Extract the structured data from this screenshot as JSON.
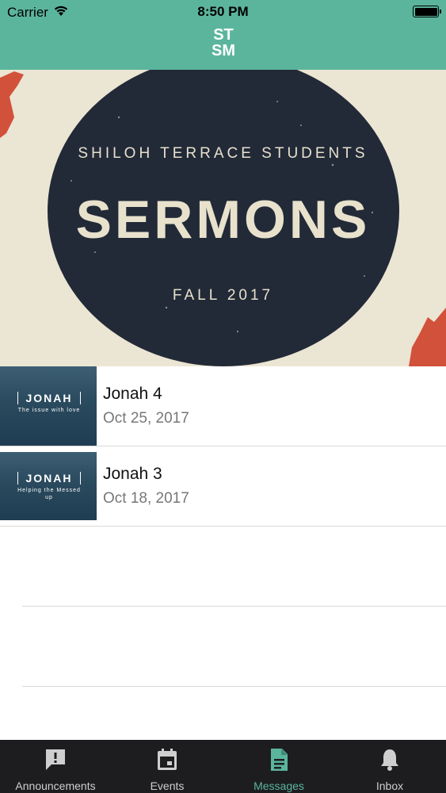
{
  "status_bar": {
    "carrier": "Carrier",
    "time": "8:50 PM"
  },
  "nav": {
    "logo_line1": "ST",
    "logo_line2": "SM"
  },
  "banner": {
    "line1": "SHILOH TERRACE STUDENTS",
    "line2": "SERMONS",
    "line3": "FALL 2017"
  },
  "sermons": [
    {
      "title": "Jonah 4",
      "date": "Oct 25, 2017",
      "thumb_title": "JONAH",
      "thumb_subtitle": "The issue with love"
    },
    {
      "title": "Jonah 3",
      "date": "Oct 18, 2017",
      "thumb_title": "JONAH",
      "thumb_subtitle": "Helping the Messed up"
    }
  ],
  "tabs": [
    {
      "label": "Announcements",
      "icon": "alert-icon"
    },
    {
      "label": "Events",
      "icon": "calendar-icon"
    },
    {
      "label": "Messages",
      "icon": "document-icon"
    },
    {
      "label": "Inbox",
      "icon": "bell-icon"
    }
  ],
  "colors": {
    "accent": "#5bb59c",
    "tabbar": "#1d1d1f",
    "banner_circle": "#222a38",
    "banner_bg": "#ebe5d3",
    "banner_red": "#d2513b"
  }
}
